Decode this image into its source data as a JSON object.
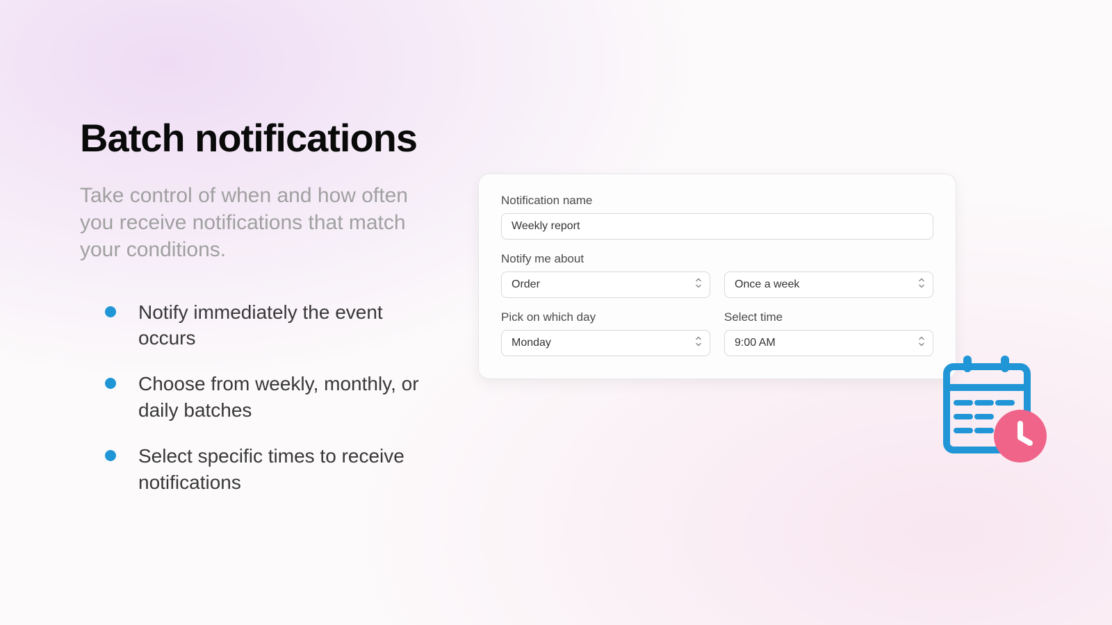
{
  "heading": "Batch notifications",
  "subheading": "Take control of when and how often you receive notifications that match your conditions.",
  "bullets": [
    "Notify immediately the event occurs",
    "Choose from weekly, monthly, or daily batches",
    "Select specific times to receive notifications"
  ],
  "form": {
    "name_label": "Notification name",
    "name_value": "Weekly report",
    "notify_label": "Notify me about",
    "notify_value": "Order",
    "frequency_value": "Once a week",
    "day_label": "Pick on which day",
    "day_value": "Monday",
    "time_label": "Select time",
    "time_value": "9:00 AM"
  },
  "colors": {
    "accent_blue": "#2196d6",
    "accent_pink": "#f06489"
  }
}
